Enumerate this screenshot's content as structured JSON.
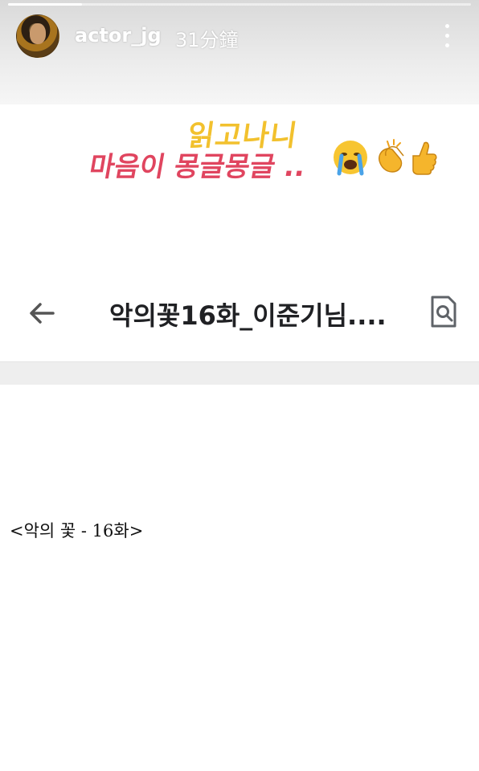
{
  "story": {
    "username": "actor_jg",
    "time": "31分鐘",
    "progress": 0.16,
    "text_line_1": "읽고나니",
    "text_line_2": "마음이 몽글몽글 ..",
    "emojis": [
      "crying-face",
      "clapping-hands",
      "thumbs-up"
    ]
  },
  "document": {
    "title": "악의꽃16화_이준기님....",
    "content": "<악의 꽃 - 16화>"
  },
  "colors": {
    "yellow_text": "#f2c12e",
    "pink_text": "#e0455f"
  }
}
